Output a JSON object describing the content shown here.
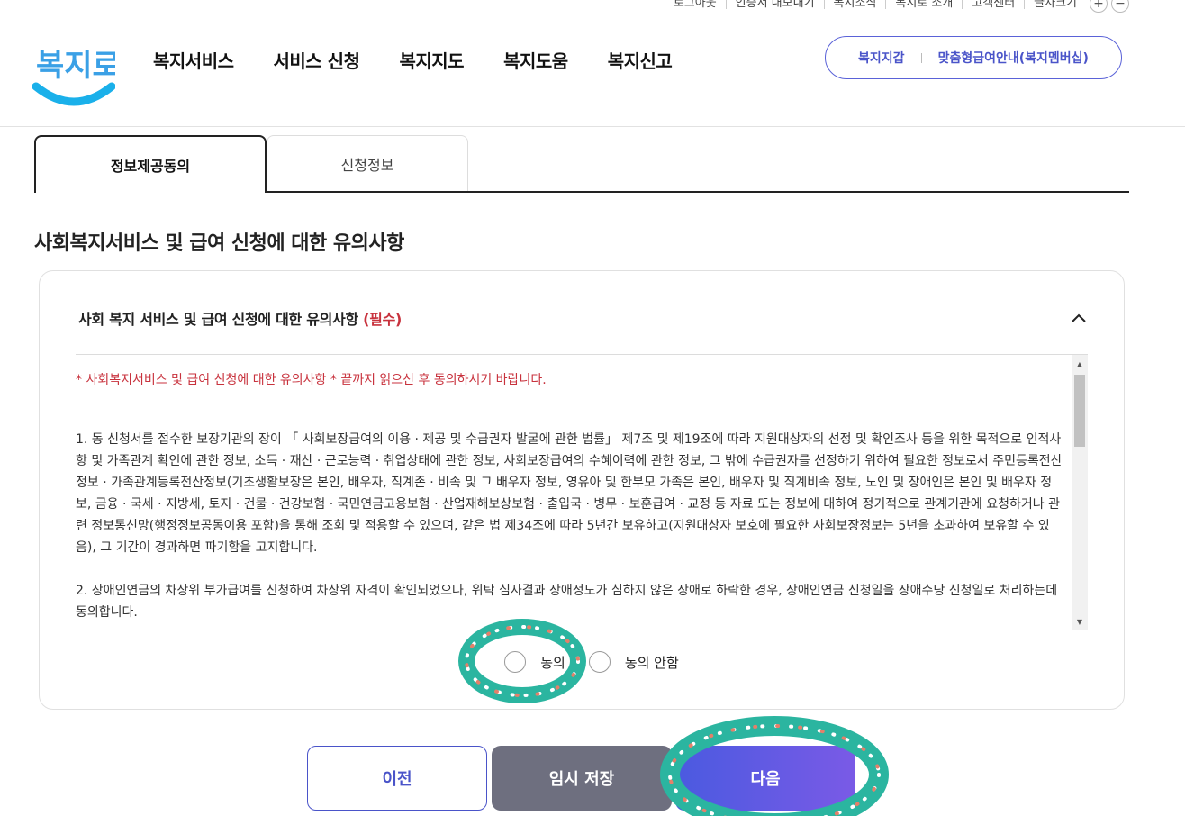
{
  "utility": {
    "items": [
      "로그아웃",
      "인증서 내보내기",
      "복지소식",
      "복지로 소개",
      "고객센터",
      "글자크기"
    ],
    "font_plus": "+",
    "font_minus": "−"
  },
  "header": {
    "logo_text": "복지로",
    "nav": [
      "복지서비스",
      "서비스 신청",
      "복지지도",
      "복지도움",
      "복지신고"
    ],
    "pill_left": "복지지갑",
    "pill_right": "맞춤형급여안내(복지멤버십)"
  },
  "tabs": [
    {
      "label": "정보제공동의",
      "active": true
    },
    {
      "label": "신청정보",
      "active": false
    }
  ],
  "section_title": "사회복지서비스 및 급여 신청에 대한 유의사항",
  "card": {
    "heading": "사회 복지 서비스 및 급여 신청에 대한 유의사항",
    "required": "(필수)",
    "notice": "* 사회복지서비스 및 급여 신청에 대한 유의사항 * 끝까지 읽으신 후 동의하시기 바랍니다.",
    "paragraph1": "1. 동 신청서를 접수한 보장기관의 장이 「 사회보장급여의 이용 · 제공 및 수급권자 발굴에 관한 법률」 제7조 및 제19조에 따라 지원대상자의 선정 및 확인조사 등을 위한 목적으로 인적사항 및 가족관계 확인에 관한 정보, 소득 · 재산 · 근로능력 · 취업상태에 관한 정보, 사회보장급여의 수혜이력에 관한 정보, 그 밖에 수급권자를 선정하기 위하여 필요한 정보로서 주민등록전산정보 · 가족관계등록전산정보(기초생활보장은 본인, 배우자, 직계존 · 비속 및 그 배우자 정보, 영유아 및 한부모 가족은 본인, 배우자 및 직계비속 정보, 노인 및 장애인은 본인 및 배우자 정보, 금융 · 국세 · 지방세, 토지 · 건물 · 건강보험 · 국민연금고용보험 · 산업재해보상보험 · 출입국 · 병무 · 보훈급여 · 교정 등 자료 또는 정보에 대하여 정기적으로 관계기관에 요청하거나 관련 정보통신망(행정정보공동이용 포함)을 통해 조회 및 적용할 수 있으며, 같은 법 제34조에 따라 5년간 보유하고(지원대상자 보호에 필요한 사회보장정보는 5년을 초과하여 보유할 수 있음), 그 기간이 경과하면 파기함을 고지합니다.",
    "paragraph2": "2. 장애인연금의 차상위 부가급여를 신청하여 차상위 자격이 확인되었으나, 위탁 심사결과 장애정도가 심하지 않은 장애로 하락한 경우, 장애인연금 신청일을 장애수당 신청일로 처리하는데 동의합니다.",
    "agree_label": "동의",
    "disagree_label": "동의 안함"
  },
  "buttons": {
    "prev": "이전",
    "save": "임시 저장",
    "next": "다음"
  },
  "colors": {
    "brand": "#4a54c9",
    "required": "#c8323d",
    "save_bg": "#6e6f7f",
    "annotation": "#2bb5a0"
  }
}
